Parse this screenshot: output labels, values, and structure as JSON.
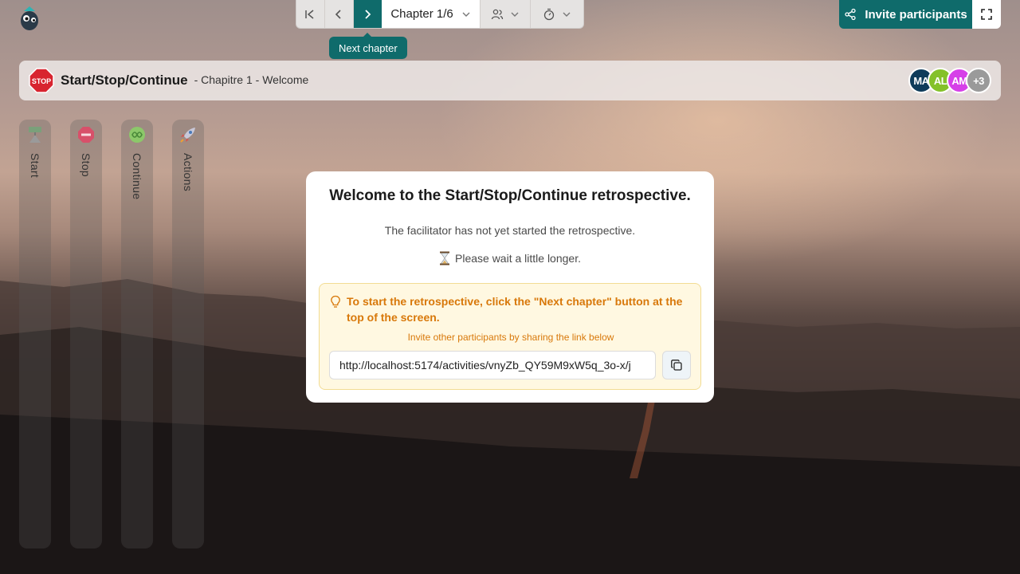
{
  "toolbar": {
    "chapter_label": "Chapter 1/6",
    "tooltip": "Next chapter"
  },
  "invite": {
    "label": "Invite participants"
  },
  "header": {
    "title": "Start/Stop/Continue",
    "subtitle": "- Chapitre 1 - Welcome",
    "stop_badge_text": "STOP",
    "avatars": [
      {
        "initials": "MA",
        "color": "#0e3b5a"
      },
      {
        "initials": "AL",
        "color": "#84c12a"
      },
      {
        "initials": "AM",
        "color": "#d63fe8"
      },
      {
        "initials": "+3",
        "color": "#9a9a9a"
      }
    ]
  },
  "columns": [
    {
      "label": "Start",
      "icon": "start-sign-icon"
    },
    {
      "label": "Stop",
      "icon": "stop-sign-icon"
    },
    {
      "label": "Continue",
      "icon": "continue-icon"
    },
    {
      "label": "Actions",
      "icon": "rocket-icon"
    }
  ],
  "modal": {
    "title": "Welcome to the Start/Stop/Continue retrospective.",
    "text": "The facilitator has not yet started the retrospective.",
    "wait": "Please wait a little longer.",
    "hint": "To start the retrospective, click the \"Next chapter\" button at the top of the screen.",
    "share_hint": "Invite other participants by sharing the link below",
    "link": "http://localhost:5174/activities/vnyZb_QY59M9xW5q_3o-x/j"
  }
}
